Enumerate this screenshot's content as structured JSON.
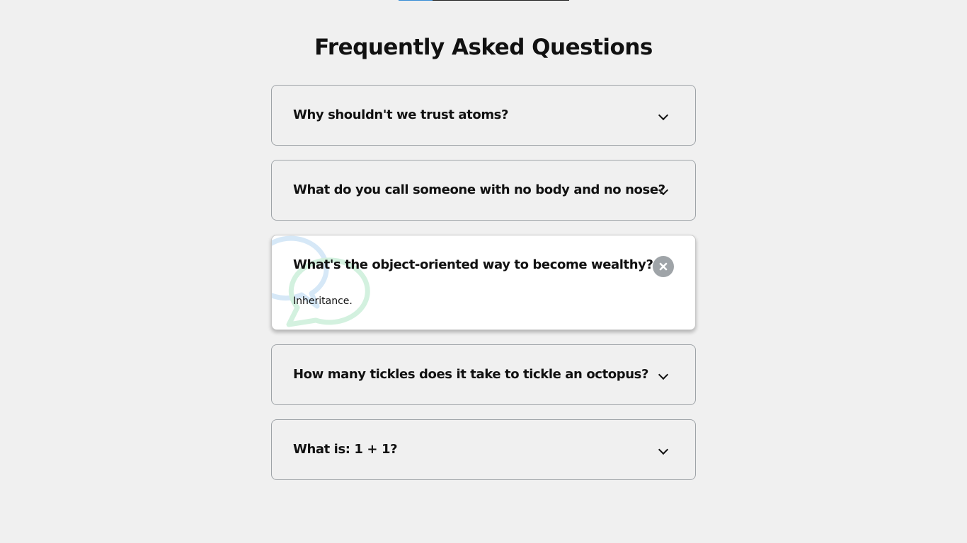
{
  "header": {
    "title": "Frequently Asked Questions"
  },
  "faqs": [
    {
      "question": "Why shouldn't we trust atoms?",
      "answer": "",
      "expanded": false,
      "icon": "chevron-down-icon"
    },
    {
      "question": "What do you call someone with no body and no nose?",
      "answer": "",
      "expanded": false,
      "icon": "chevron-down-icon"
    },
    {
      "question": "What's the object-oriented way to become wealthy?",
      "answer": "Inheritance.",
      "expanded": true,
      "icon": "close-icon"
    },
    {
      "question": "How many tickles does it take to tickle an octopus?",
      "answer": "",
      "expanded": false,
      "icon": "chevron-down-icon"
    },
    {
      "question": "What is: 1 + 1?",
      "answer": "",
      "expanded": false,
      "icon": "chevron-down-icon"
    }
  ],
  "colors": {
    "background": "#f0f0f0",
    "card_border": "#9fa4a8",
    "active_card": "#ffffff",
    "close_button": "#9fa4a8",
    "bubble_blue": "#d6e8f7",
    "bubble_green": "#d3f1df",
    "accent_bar": "#3a8fd6"
  }
}
